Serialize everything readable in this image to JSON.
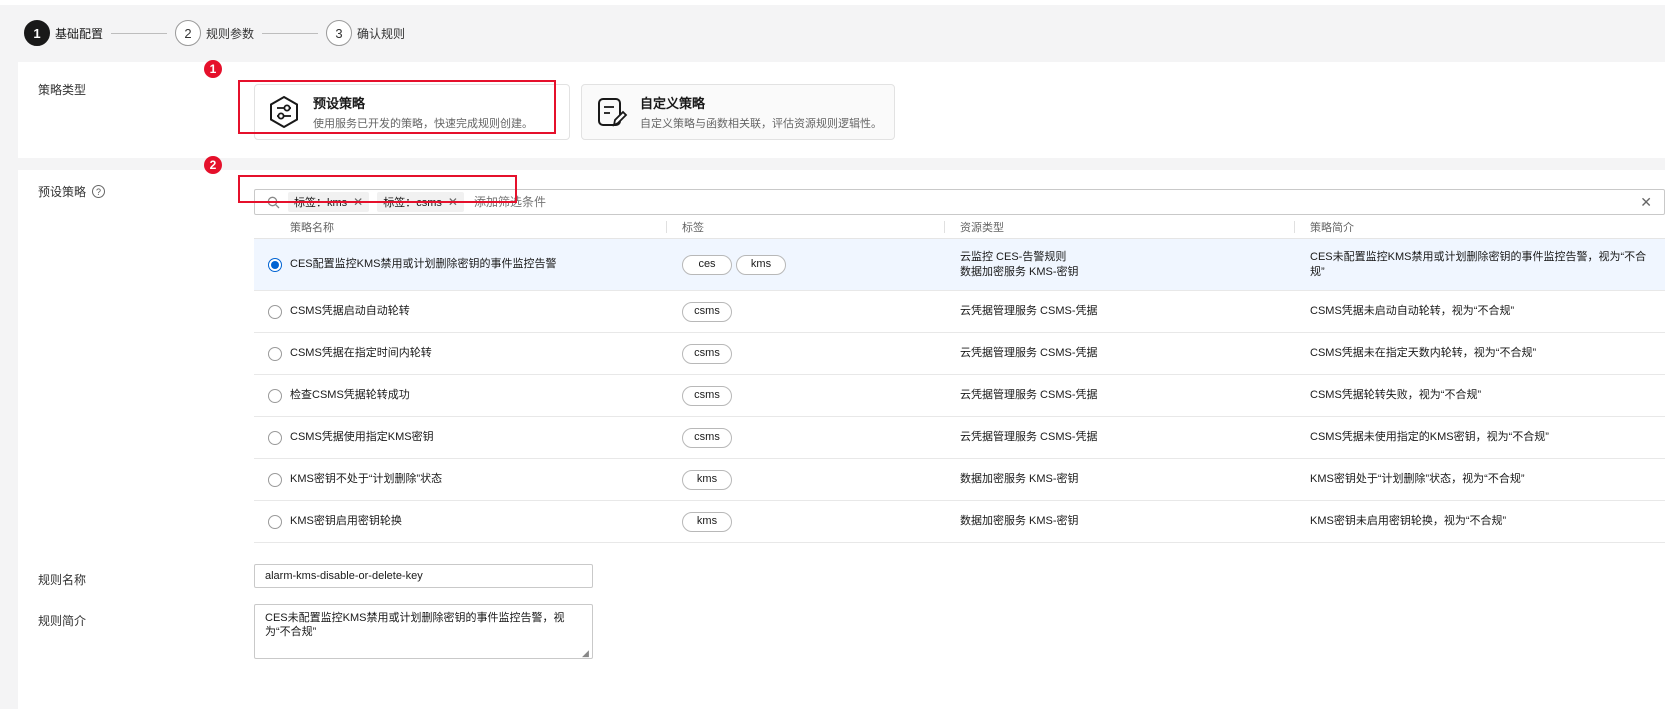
{
  "steps": [
    {
      "num": "1",
      "label": "基础配置"
    },
    {
      "num": "2",
      "label": "规则参数"
    },
    {
      "num": "3",
      "label": "确认规则"
    }
  ],
  "policy_type": {
    "label": "策略类型",
    "options": [
      {
        "title": "预设策略",
        "desc": "使用服务已开发的策略，快速完成规则创建。",
        "icon": "preset-policy-icon"
      },
      {
        "title": "自定义策略",
        "desc": "自定义策略与函数相关联，评估资源规则逻辑性。",
        "icon": "custom-policy-icon"
      }
    ]
  },
  "annotations": [
    "1",
    "2"
  ],
  "preset": {
    "label": "预设策略",
    "help": "?",
    "filters": [
      {
        "text": "标签：kms"
      },
      {
        "text": "标签：csms"
      }
    ],
    "search_placeholder": "添加筛选条件",
    "clear": "✕",
    "columns": [
      "策略名称",
      "标签",
      "资源类型",
      "策略简介"
    ],
    "rows": [
      {
        "name": "CES配置监控KMS禁用或计划删除密钥的事件监控告警",
        "tags": [
          "ces",
          "kms"
        ],
        "resource": [
          "云监控 CES-告警规则",
          "数据加密服务 KMS-密钥"
        ],
        "desc": "CES未配置监控KMS禁用或计划删除密钥的事件监控告警，视为“不合规”",
        "selected": true
      },
      {
        "name": "CSMS凭据启动自动轮转",
        "tags": [
          "csms"
        ],
        "resource": [
          "云凭据管理服务 CSMS-凭据"
        ],
        "desc": "CSMS凭据未启动自动轮转，视为“不合规”",
        "selected": false
      },
      {
        "name": "CSMS凭据在指定时间内轮转",
        "tags": [
          "csms"
        ],
        "resource": [
          "云凭据管理服务 CSMS-凭据"
        ],
        "desc": "CSMS凭据未在指定天数内轮转，视为“不合规”",
        "selected": false
      },
      {
        "name": "检查CSMS凭据轮转成功",
        "tags": [
          "csms"
        ],
        "resource": [
          "云凭据管理服务 CSMS-凭据"
        ],
        "desc": "CSMS凭据轮转失败，视为“不合规”",
        "selected": false
      },
      {
        "name": "CSMS凭据使用指定KMS密钥",
        "tags": [
          "csms"
        ],
        "resource": [
          "云凭据管理服务 CSMS-凭据"
        ],
        "desc": "CSMS凭据未使用指定的KMS密钥，视为“不合规”",
        "selected": false
      },
      {
        "name": "KMS密钥不处于“计划删除”状态",
        "tags": [
          "kms"
        ],
        "resource": [
          "数据加密服务 KMS-密钥"
        ],
        "desc": "KMS密钥处于“计划删除”状态，视为“不合规”",
        "selected": false
      },
      {
        "name": "KMS密钥启用密钥轮换",
        "tags": [
          "kms"
        ],
        "resource": [
          "数据加密服务 KMS-密钥"
        ],
        "desc": "KMS密钥未启用密钥轮换，视为“不合规”",
        "selected": false
      }
    ]
  },
  "rule_name": {
    "label": "规则名称",
    "value": "alarm-kms-disable-or-delete-key"
  },
  "rule_desc": {
    "label": "规则简介",
    "value": "CES未配置监控KMS禁用或计划删除密钥的事件监控告警，视为“不合规”"
  },
  "colors": {
    "accent": "#0063d3",
    "annotation": "#e5102b",
    "selected_row": "#f0f6ff"
  }
}
